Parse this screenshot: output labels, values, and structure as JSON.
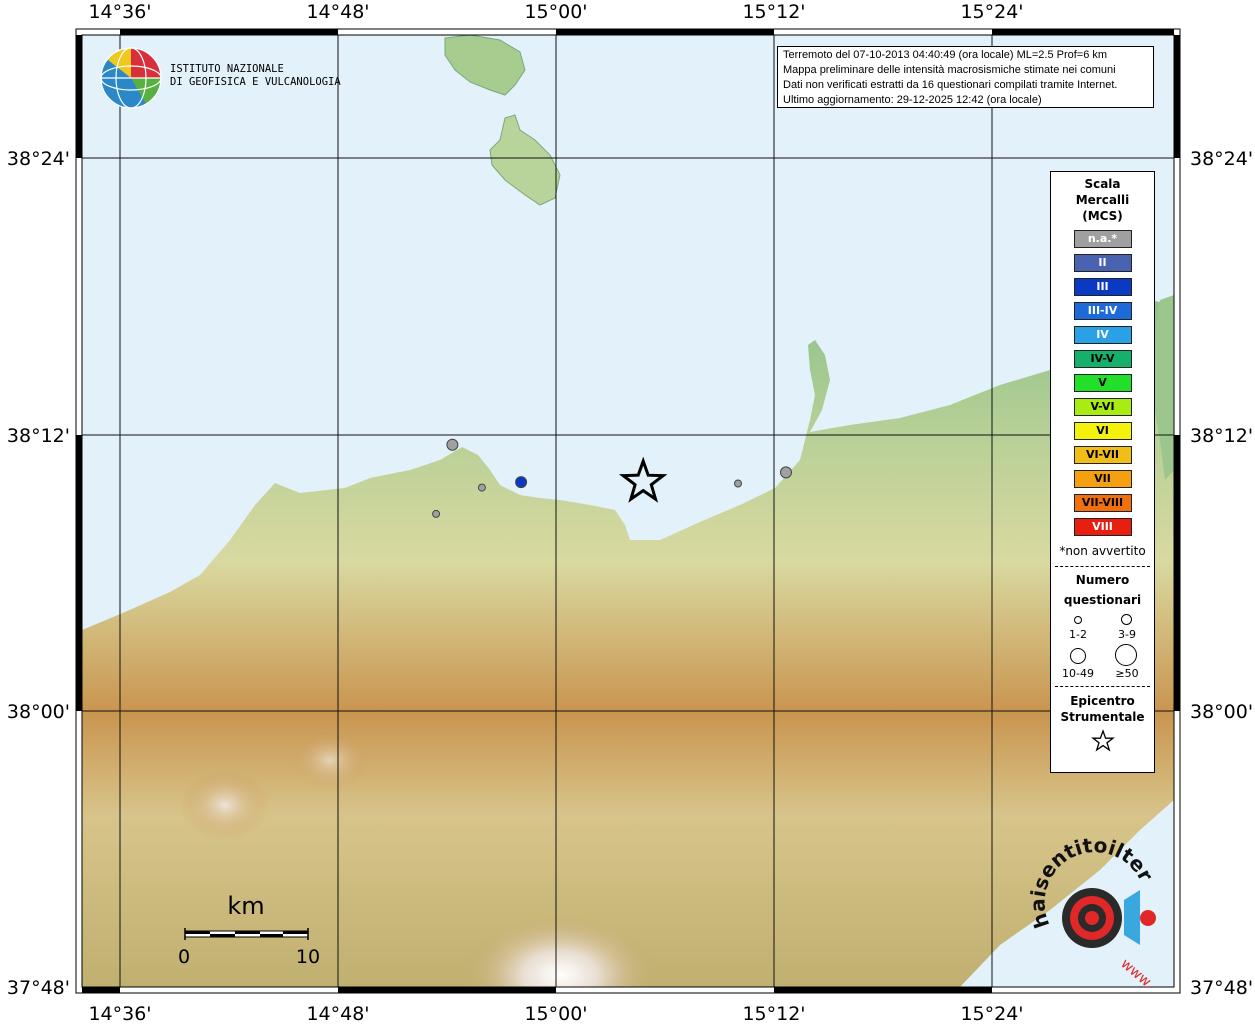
{
  "info": {
    "line1": "Terremoto del 07-10-2013 04:40:49 (ora locale) ML=2.5 Prof=6 km",
    "line2": "Mappa preliminare delle intensità macrosismiche stimate nei comuni",
    "line3": "Dati non verificati estratti da 16 questionari compilati tramite Internet.",
    "line4": "Ultimo aggiornamento: 29-12-2025 12:42 (ora locale)"
  },
  "institute": {
    "line1": "ISTITUTO NAZIONALE",
    "line2": "DI GEOFISICA E VULCANOLOGIA"
  },
  "axes": {
    "lon_ticks": [
      "14°36'",
      "14°48'",
      "15°00'",
      "15°12'",
      "15°24'"
    ],
    "lat_ticks": [
      "38°24'",
      "38°12'",
      "38°00'",
      "37°48'"
    ]
  },
  "legend": {
    "title1": "Scala",
    "title2": "Mercalli",
    "title3": "(MCS)",
    "intensities": [
      {
        "label": "n.a.*",
        "color": "#a0a0a0"
      },
      {
        "label": "II",
        "color": "#4a63b0"
      },
      {
        "label": "III",
        "color": "#0a3ac4"
      },
      {
        "label": "III-IV",
        "color": "#1e6ad8"
      },
      {
        "label": "IV",
        "color": "#2aa0e6"
      },
      {
        "label": "IV-V",
        "color": "#17b06a"
      },
      {
        "label": "V",
        "color": "#22e02a"
      },
      {
        "label": "V-VI",
        "color": "#a8ec14"
      },
      {
        "label": "VI",
        "color": "#f4f20c"
      },
      {
        "label": "VI-VII",
        "color": "#f0be16"
      },
      {
        "label": "VII",
        "color": "#f4a010"
      },
      {
        "label": "VII-VIII",
        "color": "#f07010"
      },
      {
        "label": "VIII",
        "color": "#e81e10"
      }
    ],
    "na_note": "*non avvertito",
    "count_title1": "Numero",
    "count_title2": "questionari",
    "sizes": [
      "1-2",
      "3-9",
      "10-49",
      "≥50"
    ],
    "epi_title1": "Epicentro",
    "epi_title2": "Strumentale"
  },
  "scale_bar": {
    "unit": "km",
    "start": "0",
    "end": "10"
  },
  "observations": [
    {
      "lon": 14.905,
      "lat": 38.193,
      "intensity": "n.a.*",
      "count": "3-9"
    },
    {
      "lon": 14.968,
      "lat": 38.166,
      "intensity": "III",
      "count": "3-9"
    },
    {
      "lon": 14.932,
      "lat": 38.162,
      "intensity": "n.a.*",
      "count": "1-2"
    },
    {
      "lon": 14.89,
      "lat": 38.143,
      "intensity": "n.a.*",
      "count": "1-2"
    },
    {
      "lon": 15.167,
      "lat": 38.165,
      "intensity": "n.a.*",
      "count": "1-2"
    },
    {
      "lon": 15.211,
      "lat": 38.173,
      "intensity": "n.a.*",
      "count": "3-9"
    }
  ],
  "epicenter": {
    "lon": 15.08,
    "lat": 38.166
  },
  "colors": {
    "sea": "#e2f1fa",
    "lowland": "#8cc28a",
    "hill": "#d8d8a0",
    "mountain": "#c8934e"
  },
  "logo": {
    "text": "haisentitoilterremoto.it",
    "sub": "www."
  }
}
